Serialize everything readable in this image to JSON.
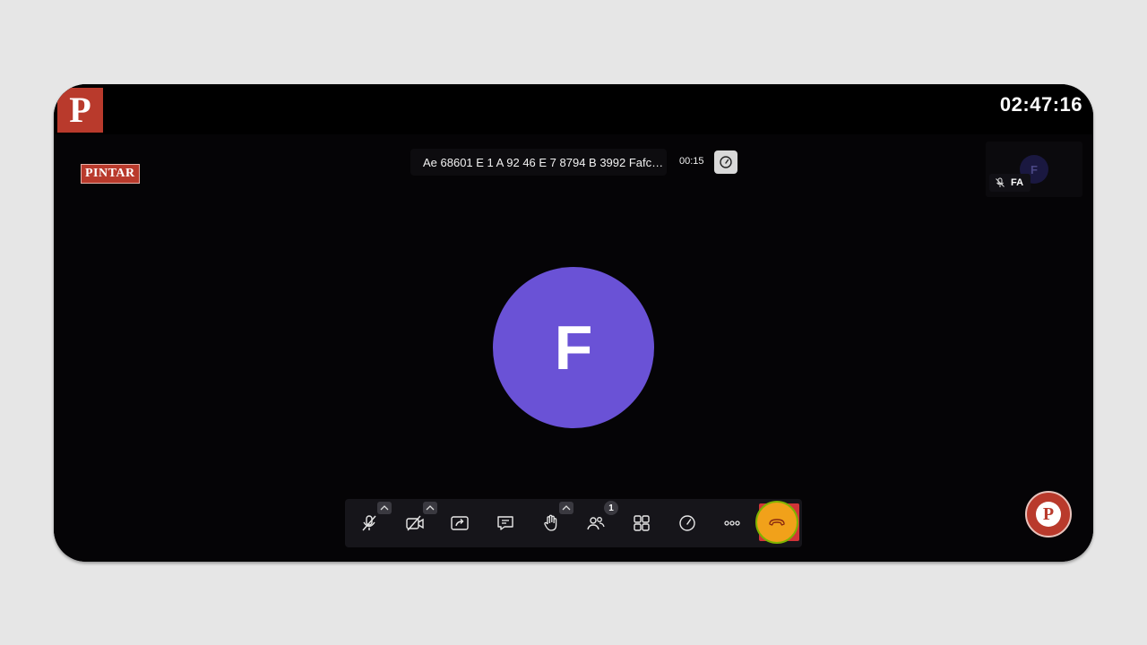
{
  "clock": "02:47:16",
  "brand": {
    "badge_text": "PINTAR",
    "logo_letter": "P",
    "fab_letter": "P"
  },
  "meeting": {
    "title": "Ae 68601 E 1 A 92 46 E 7 8794 B 3992 Fafc…",
    "elapsed": "00:15"
  },
  "participants": {
    "main_initial": "F",
    "thumb_initial": "F",
    "thumb_label": "FA",
    "count_badge": "1"
  },
  "colors": {
    "brand_red": "#b93a2c",
    "avatar_purple": "#6a52d6",
    "end_call_red": "#d13438",
    "highlight_orange": "#f1a11a"
  },
  "toolbar": {
    "icons": [
      "mic-off-icon",
      "camera-off-icon",
      "share-screen-icon",
      "chat-icon",
      "raise-hand-icon",
      "participants-icon",
      "layout-grid-icon",
      "speed-icon",
      "more-icon",
      "end-call-icon"
    ]
  }
}
